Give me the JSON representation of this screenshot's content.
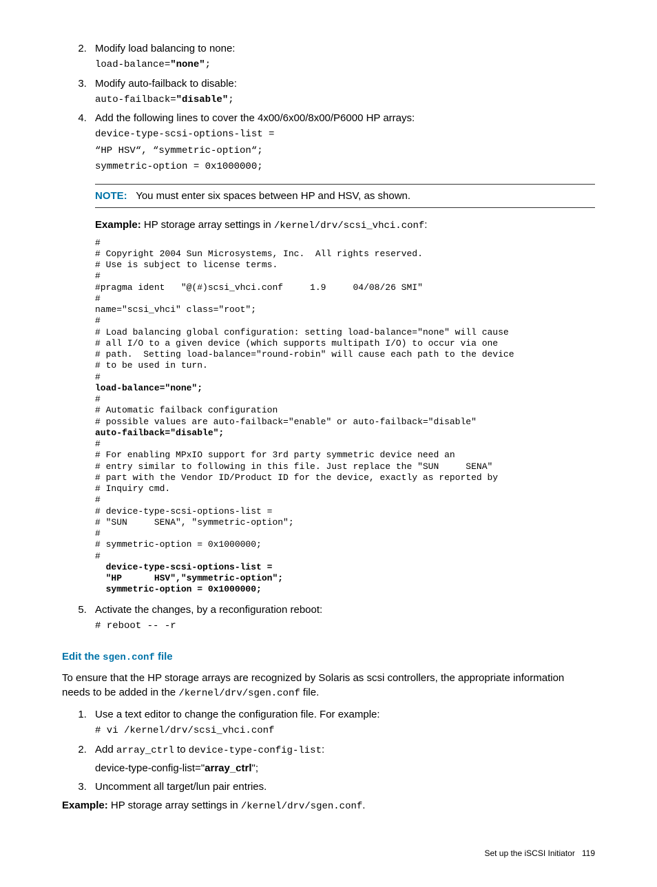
{
  "list1": {
    "item2": {
      "text": "Modify load balancing to none:",
      "code_1": "load-balance=",
      "code_2": "\"none\"",
      "code_3": ";"
    },
    "item3": {
      "text": "Modify auto-failback to disable:",
      "code_1": "auto-failback=",
      "code_2": "\"disable\"",
      "code_3": ";"
    },
    "item4": {
      "text": "Add the following lines to cover the 4x00/6x00/8x00/P6000 HP arrays:",
      "code_a": "device-type-scsi-options-list =",
      "code_b": "“HP HSV“, “symmetric-option“;",
      "code_c": "symmetric-option = 0x1000000;"
    },
    "item5": {
      "text": "Activate the changes, by a reconfiguration reboot:",
      "code": "# reboot -- -r"
    }
  },
  "note": {
    "label": "NOTE:",
    "text": "You must enter six spaces between HP and HSV, as shown."
  },
  "example1": {
    "label": "Example:",
    "pre": " HP storage array settings in ",
    "path": "/kernel/drv/scsi_vhci.conf",
    "post": ":"
  },
  "codeblock": {
    "l1": "#",
    "l2": "# Copyright 2004 Sun Microsystems, Inc.  All rights reserved.",
    "l3": "# Use is subject to license terms.",
    "l4": "#",
    "l5": "#pragma ident   \"@(#)scsi_vhci.conf     1.9     04/08/26 SMI\"",
    "l6": "#",
    "l7": "name=\"scsi_vhci\" class=\"root\";",
    "l8": "#",
    "l9": "# Load balancing global configuration: setting load-balance=\"none\" will cause",
    "l10": "# all I/O to a given device (which supports multipath I/O) to occur via one",
    "l11": "# path.  Setting load-balance=\"round-robin\" will cause each path to the device",
    "l12": "# to be used in turn.",
    "l13": "#",
    "l14": "load-balance=\"none\";",
    "l15": "#",
    "l16": "# Automatic failback configuration",
    "l17": "# possible values are auto-failback=\"enable\" or auto-failback=\"disable\"",
    "l18": "auto-failback=\"disable\";",
    "l19": "#",
    "l20": "# For enabling MPxIO support for 3rd party symmetric device need an",
    "l21": "# entry similar to following in this file. Just replace the \"SUN     SENA\"",
    "l22": "# part with the Vendor ID/Product ID for the device, exactly as reported by",
    "l23": "# Inquiry cmd.",
    "l24": "#",
    "l25": "# device-type-scsi-options-list =",
    "l26": "# \"SUN     SENA\", \"symmetric-option\";",
    "l27": "#",
    "l28": "# symmetric-option = 0x1000000;",
    "l29": "#",
    "l30": "  device-type-scsi-options-list =",
    "l31": "  \"HP      HSV\",\"symmetric-option\";",
    "l32": "  symmetric-option = 0x1000000;"
  },
  "section2": {
    "heading_pre": "Edit the ",
    "heading_code": "sgen.conf",
    "heading_post": " file",
    "para_a": "To ensure that the HP storage arrays are recognized by Solaris as scsi controllers, the appropriate information needs to be added in the ",
    "para_path": "/kernel/drv/sgen.conf",
    "para_b": " file."
  },
  "list2": {
    "item1": {
      "text": "Use a text editor to change the configuration file. For example:",
      "code": "# vi /kernel/drv/scsi_vhci.conf"
    },
    "item2": {
      "text_a": "Add ",
      "code_a": "array_ctrl",
      "text_b": " to ",
      "code_b": "device-type-config-list",
      "text_c": ":",
      "line2_a": "device-type-config-list=\"",
      "line2_b": "array_ctrl",
      "line2_c": "\";"
    },
    "item3": {
      "text": "Uncomment all target/lun pair entries."
    }
  },
  "example2": {
    "label": "Example:",
    "pre": " HP storage array settings in ",
    "path": "/kernel/drv/sgen.conf",
    "post": "."
  },
  "footer": {
    "text": "Set up the iSCSI Initiator",
    "page": "119"
  }
}
